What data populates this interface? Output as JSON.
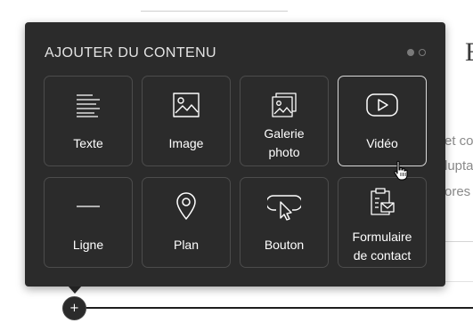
{
  "panel": {
    "title": "AJOUTER DU CONTENU",
    "pages": 2,
    "active_page": 1
  },
  "tiles": [
    {
      "label": "Texte",
      "icon": "text-lines-icon",
      "selected": false
    },
    {
      "label": "Image",
      "icon": "image-icon",
      "selected": false
    },
    {
      "label": "Galerie\nphoto",
      "icon": "photo-gallery-icon",
      "selected": false
    },
    {
      "label": "Vidéo",
      "icon": "video-play-icon",
      "selected": true
    },
    {
      "label": "Ligne",
      "icon": "horizontal-line-icon",
      "selected": false
    },
    {
      "label": "Plan",
      "icon": "map-pin-icon",
      "selected": false
    },
    {
      "label": "Bouton",
      "icon": "button-click-icon",
      "selected": false
    },
    {
      "label": "Formulaire\nde contact",
      "icon": "contact-form-icon",
      "selected": false
    }
  ],
  "add_handle": {
    "symbol": "+"
  },
  "background": {
    "heading_fragment": "E",
    "text_fragments": [
      "et co",
      "lupta",
      "ores"
    ]
  },
  "colors": {
    "panel_bg": "#2b2b2b",
    "tile_border": "#4c4c4c",
    "tile_selected_border": "#d9d9d9",
    "text": "#ffffff"
  }
}
